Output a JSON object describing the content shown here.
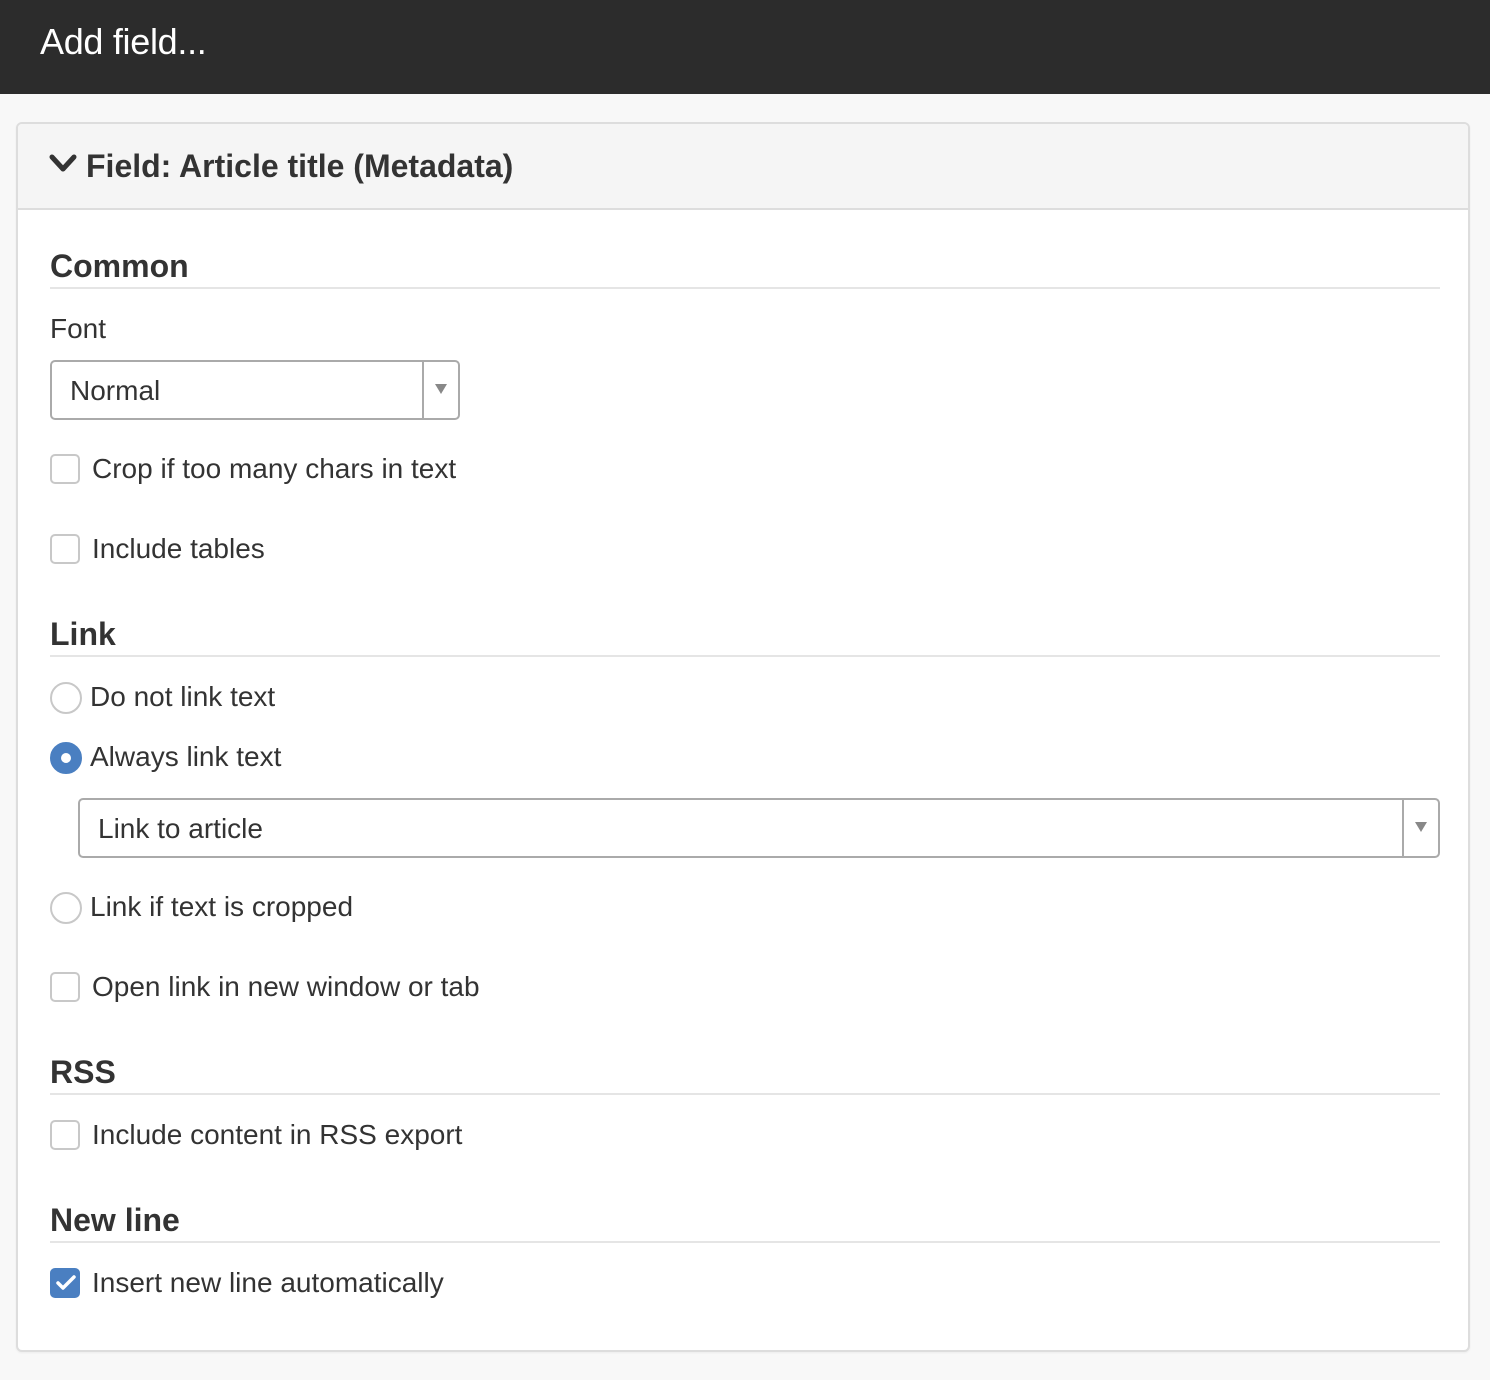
{
  "window": {
    "title": "Add field..."
  },
  "panel": {
    "title": "Field: Article title (Metadata)",
    "collapse_icon": "chevron-down-icon"
  },
  "sections": {
    "common": {
      "heading": "Common",
      "font": {
        "label": "Font",
        "selected": "Normal"
      },
      "crop": {
        "label": "Crop if too many chars in text",
        "checked": false
      },
      "include_tables": {
        "label": "Include tables",
        "checked": false
      }
    },
    "link": {
      "heading": "Link",
      "options": [
        {
          "label": "Do not link text",
          "selected": false
        },
        {
          "label": "Always link text",
          "selected": true
        },
        {
          "label": "Link if text is cropped",
          "selected": false
        }
      ],
      "link_target": {
        "selected": "Link to article"
      },
      "new_window": {
        "label": "Open link in new window or tab",
        "checked": false
      }
    },
    "rss": {
      "heading": "RSS",
      "include_rss": {
        "label": "Include content in RSS export",
        "checked": false
      }
    },
    "new_line": {
      "heading": "New line",
      "insert_new_line": {
        "label": "Insert new line automatically",
        "checked": true
      }
    }
  },
  "colors": {
    "titlebar": "#2c2c2c",
    "accent": "#4a7fc1",
    "panel_header": "#f5f5f5"
  }
}
